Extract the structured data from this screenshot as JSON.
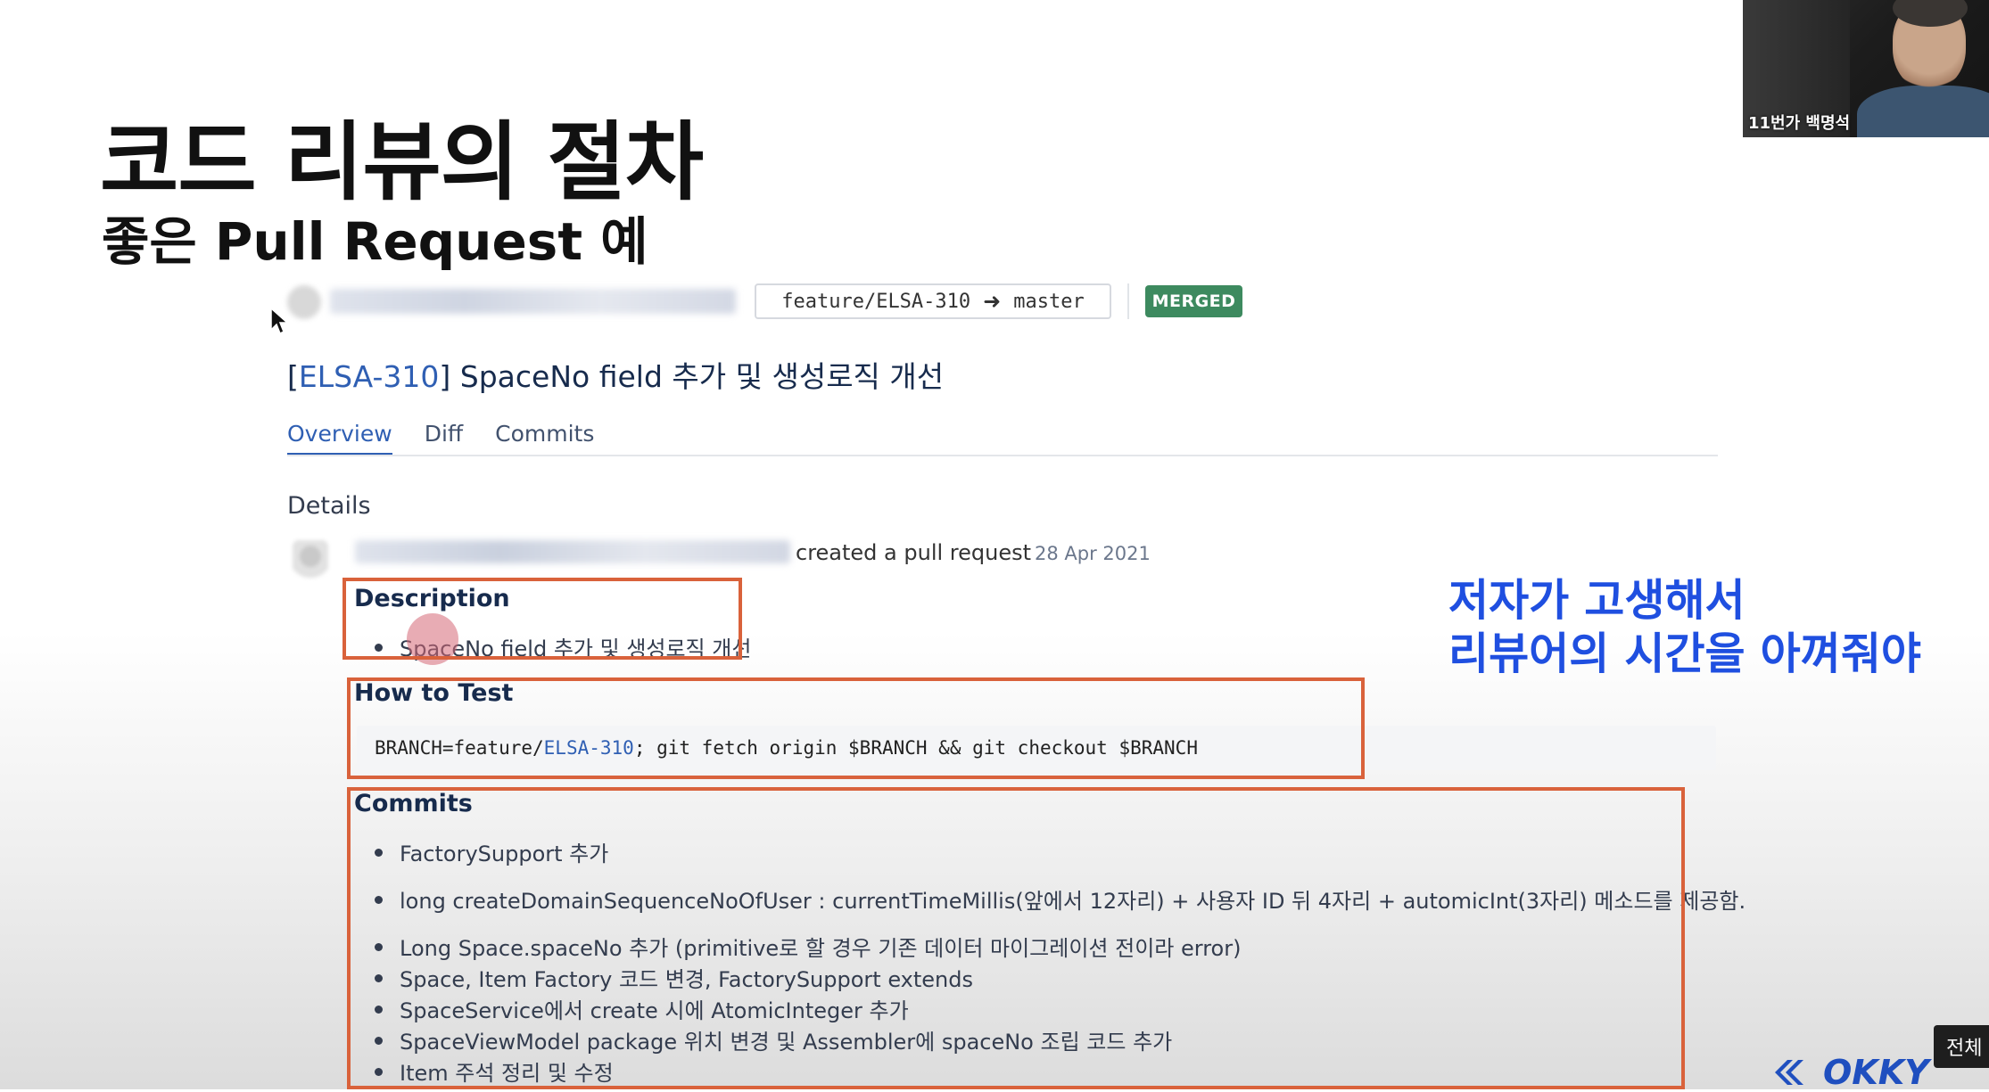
{
  "slide": {
    "title": "코드 리뷰의 절차",
    "subtitle": "좋은 Pull Request 예"
  },
  "pr": {
    "source_branch": "feature/ELSA-310",
    "target_branch": "master",
    "arrow_glyph": "➜",
    "status_badge": "MERGED",
    "title_bracket_open": "[",
    "title_key": "ELSA-310",
    "title_bracket_close": "]",
    "title_text": " SpaceNo field 추가 및 생성로직 개선",
    "tabs": [
      {
        "label": "Overview",
        "active": true
      },
      {
        "label": "Diff",
        "active": false
      },
      {
        "label": "Commits",
        "active": false
      }
    ],
    "details_label": "Details",
    "activity_text": "created a pull request",
    "activity_date": "28 Apr 2021",
    "description": {
      "heading": "Description",
      "items": [
        "SpaceNo field 추가 및 생성로직 개선"
      ]
    },
    "how_to_test": {
      "heading": "How to Test",
      "code_prefix": "BRANCH=feature/",
      "code_key": "ELSA-310",
      "code_suffix": "; git fetch origin $BRANCH && git checkout $BRANCH"
    },
    "commits": {
      "heading": "Commits",
      "items": [
        "FactorySupport 추가",
        "long createDomainSequenceNoOfUser : currentTimeMillis(앞에서 12자리) + 사용자 ID 뒤 4자리 + automicInt(3자리) 메소드를 제공함.",
        "Long Space.spaceNo 추가 (primitive로 할 경우 기존 데이터 마이그레이션 전이라 error)",
        "Space, Item Factory 코드 변경, FactorySupport extends",
        "SpaceService에서 create 시에 AtomicInteger 추가",
        "SpaceViewModel package 위치 변경 및 Assembler에 spaceNo 조립 코드 추가",
        "Item 주석 정리 및 수정"
      ]
    }
  },
  "annotation": {
    "line1": "저자가 고생해서",
    "line2": "리뷰어의 시간을 아껴줘야"
  },
  "webcam": {
    "label": "11번가 백명석"
  },
  "player": {
    "fullscreen_label": "전체"
  },
  "brand": {
    "logo_text": "OKKY"
  },
  "colors": {
    "highlight_box": "#d9623b",
    "annotation_text": "#1f4fe0",
    "merged_badge": "#3d8a5f",
    "link_blue": "#2f5fb3"
  }
}
